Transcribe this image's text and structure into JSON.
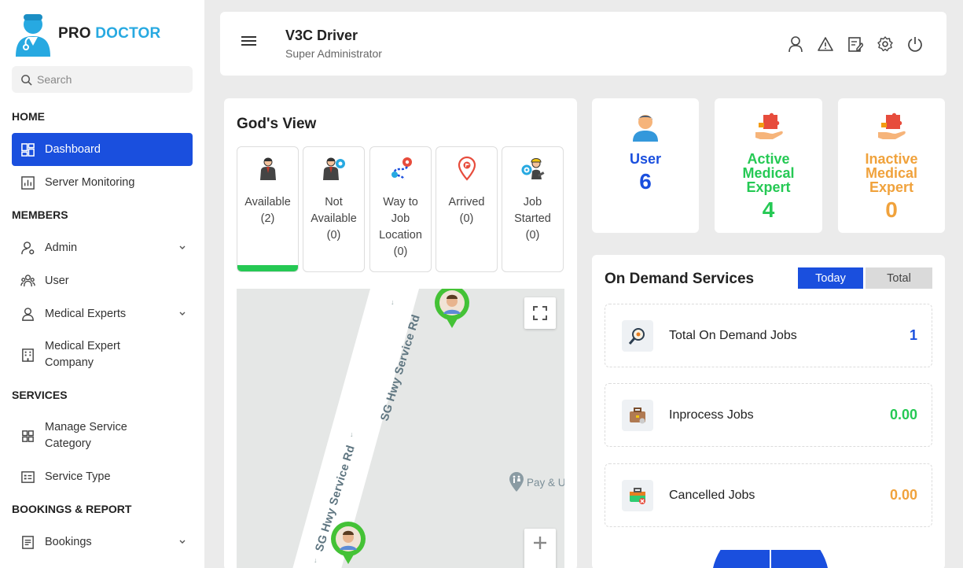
{
  "brand": {
    "pro": "PRO",
    "doctor": "DOCTOR"
  },
  "search": {
    "placeholder": "Search"
  },
  "sidebar": {
    "sections": [
      "HOME",
      "MEMBERS",
      "SERVICES",
      "BOOKINGS & REPORT"
    ],
    "items": [
      {
        "label": "Dashboard",
        "icon": "dashboard-icon"
      },
      {
        "label": "Server Monitoring",
        "icon": "chart-icon"
      },
      {
        "label": "Admin",
        "icon": "admin-icon"
      },
      {
        "label": "User",
        "icon": "users-icon"
      },
      {
        "label": "Medical Experts",
        "icon": "person-icon"
      },
      {
        "label": "Medical Expert",
        "label2": "Company",
        "icon": "building-icon"
      },
      {
        "label": "Manage Service",
        "label2": "Category",
        "icon": "grid-icon"
      },
      {
        "label": "Service Type",
        "icon": "list-icon"
      },
      {
        "label": "Bookings",
        "icon": "document-icon"
      }
    ]
  },
  "header": {
    "name": "V3C Driver",
    "role": "Super Administrator"
  },
  "gods_view": {
    "title": "God's View",
    "statuses": [
      {
        "lines": [
          "Available",
          "(2)"
        ]
      },
      {
        "lines": [
          "Not",
          "Available",
          "(0)"
        ]
      },
      {
        "lines": [
          "Way to",
          "Job",
          "Location",
          "(0)"
        ]
      },
      {
        "lines": [
          "Arrived",
          "(0)"
        ]
      },
      {
        "lines": [
          "Job",
          "Started",
          "(0)"
        ]
      }
    ],
    "map": {
      "road": "SG Hwy Service Rd",
      "poi": "Pay & U"
    }
  },
  "stats": [
    {
      "label_lines": [
        "User"
      ],
      "value": "6",
      "color": "#1a4fde"
    },
    {
      "label_lines": [
        "Active",
        "Medical",
        "Expert"
      ],
      "value": "4",
      "color": "#25c954"
    },
    {
      "label_lines": [
        "Inactive",
        "Medical",
        "Expert"
      ],
      "value": "0",
      "color": "#f0a23c"
    }
  ],
  "on_demand": {
    "title": "On Demand Services",
    "tabs": [
      "Today",
      "Total"
    ],
    "rows": [
      {
        "label": "Total On Demand Jobs",
        "value": "1",
        "color": "#1a4fde"
      },
      {
        "label": "Inprocess Jobs",
        "value": "0.00",
        "color": "#25c954"
      },
      {
        "label": "Cancelled Jobs",
        "value": "0.00",
        "color": "#f0a23c"
      }
    ]
  }
}
